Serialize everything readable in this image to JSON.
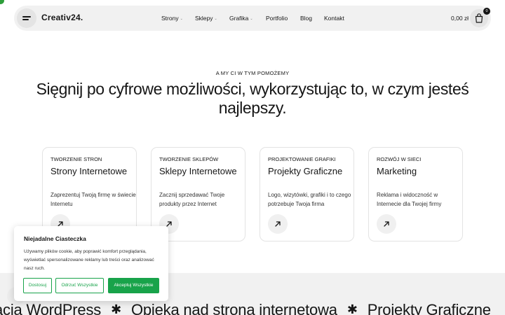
{
  "header": {
    "logo": "Creativ24.",
    "nav": [
      {
        "label": "Strony",
        "has_dropdown": true
      },
      {
        "label": "Sklepy",
        "has_dropdown": true
      },
      {
        "label": "Grafika",
        "has_dropdown": true
      },
      {
        "label": "Portfolio",
        "has_dropdown": false
      },
      {
        "label": "Blog",
        "has_dropdown": false
      },
      {
        "label": "Kontakt",
        "has_dropdown": false
      }
    ],
    "cart_total": "0,00 zł",
    "cart_count": "0",
    "dropdown_glyph": "⌄"
  },
  "hero": {
    "eyebrow": "A MY CI W TYM POMOŻEMY",
    "title": "Sięgnij po cyfrowe możliwości, wykorzystując to, w czym jesteś najlepszy."
  },
  "cards": [
    {
      "tag": "TWORZENIE STRON",
      "title": "Strony Internetowe",
      "desc": "Zaprezentuj Twoją firmę w świecie Internetu",
      "icon": "arrow-up-right-icon"
    },
    {
      "tag": "TWORZENIE SKLEPÓW",
      "title": "Sklepy Internetowe",
      "desc": "Zacznij sprzedawać Twoje produkty przez Internet",
      "icon": "arrow-up-right-icon"
    },
    {
      "tag": "PROJEKTOWANIE GRAFIKI",
      "title": "Projekty Graficzne",
      "desc": "Logo, wizytówki, grafiki i to czego potrzebuje Twoja firma",
      "icon": "arrow-up-right-icon"
    },
    {
      "tag": "ROZWÓJ W SIECI",
      "title": "Marketing",
      "desc": "Reklama i widoczność w Internecie dla Twojej firmy",
      "icon": "arrow-up-right-icon"
    }
  ],
  "ticker": {
    "items": [
      "acja WordPress",
      "Opieka nad stroną internetową",
      "Projekty Graficzne"
    ],
    "separator": "✱"
  },
  "cookie": {
    "title": "Niejadalne Ciasteczka",
    "text": "Używamy plików cookie, aby poprawić komfort przeglądania, wyświetlać spersonalizowane reklamy lub treści oraz analizować nasz ruch.",
    "buttons": {
      "customize": "Dostosuj",
      "reject": "Odrzuć Wszystkie",
      "accept": "Akceptuj Wszystkie"
    }
  },
  "colors": {
    "accent": "#18a34a",
    "band": "#f1f1f1",
    "header": "#f1f1f1"
  }
}
